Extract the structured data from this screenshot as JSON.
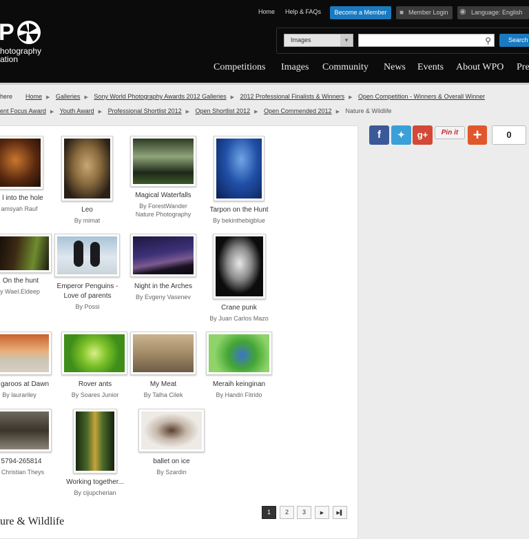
{
  "header": {
    "logo_text": "WPO",
    "logo_tagline_1": "hotography",
    "logo_tagline_2": "ation",
    "links": {
      "home": "Home",
      "help": "Help & FAQs"
    },
    "become_member": "Become a Member",
    "member_login": "Member Login",
    "language": "Language: English",
    "search": {
      "category": "Images",
      "placeholder": "",
      "button": "Search"
    },
    "nav": [
      "Competitions",
      "Images",
      "Community",
      "News",
      "Events",
      "About WPO",
      "Pre"
    ]
  },
  "breadcrumbs": {
    "prefix": "here",
    "row1": [
      "Home",
      "Galleries",
      "Sony World Photography Awards 2012 Galleries",
      "2012 Professional Finalists & Winners",
      "Open Competition - Winners & Overall Winner"
    ],
    "row2": [
      "ent Focus Award",
      "Youth Award",
      "Professional Shortlist 2012",
      "Open Shortlist 2012",
      "Open Commended 2012"
    ],
    "current": "Nature & Wildlife"
  },
  "social": {
    "share_count": "0",
    "pinit": "Pin it"
  },
  "gallery": [
    {
      "title": "l into the hole",
      "by": "amsyah Rauf"
    },
    {
      "title": "Leo",
      "by": "By mimat"
    },
    {
      "title": "Magical Waterfalls",
      "by": "By ForestWander",
      "by2": "Nature Photography"
    },
    {
      "title": "Tarpon on the Hunt",
      "by": "By bekinthebigblue"
    },
    {
      "title": "On the hunt",
      "by": "y Wael.Eldeep"
    },
    {
      "title": "Emperor Penguins -",
      "title2": "Love of parents",
      "by": "By Possi"
    },
    {
      "title": "Night in the Arches",
      "by": "By Evgeny Vasenev"
    },
    {
      "title": "Crane punk",
      "by": "By Juan Carlos Mazo"
    },
    {
      "title": "garoos at Dawn",
      "by": "By laurariley"
    },
    {
      "title": "Rover ants",
      "by": "By Soares Junior"
    },
    {
      "title": "My Meat",
      "by": "By Talha Cilek"
    },
    {
      "title": "Meraih keinginan",
      "by": "By Handri Fitrido"
    },
    {
      "title": "5794-265814",
      "by": "Christian Theys"
    },
    {
      "title": "Working together...",
      "by": "By cijupcherian"
    },
    {
      "title": "ballet on ice",
      "by": "By Szardin"
    }
  ],
  "pagination": {
    "pages": [
      "1",
      "2",
      "3"
    ],
    "next": "▶",
    "last": "▶▌",
    "current": "1"
  },
  "section_title": "ure & Wildlife"
}
